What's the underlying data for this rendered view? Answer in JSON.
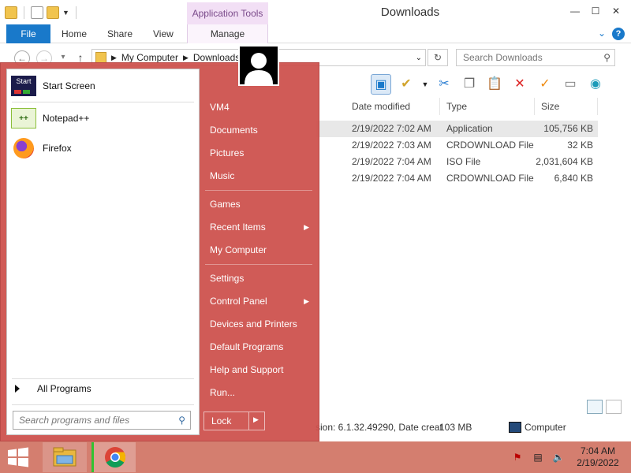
{
  "window": {
    "title": "Downloads",
    "context_tab_group": "Application Tools",
    "ribbon_tabs": [
      "File",
      "Home",
      "Share",
      "View",
      "Manage"
    ],
    "address_path": [
      "My Computer",
      "Downloads"
    ],
    "search_placeholder": "Search Downloads",
    "columns": [
      "Date modified",
      "Type",
      "Size"
    ],
    "files": [
      {
        "date": "2/19/2022 7:02 AM",
        "type": "Application",
        "size": "105,756 KB",
        "selected": true
      },
      {
        "date": "2/19/2022 7:03 AM",
        "type": "CRDOWNLOAD File",
        "size": "32 KB",
        "selected": false
      },
      {
        "date": "2/19/2022 7:04 AM",
        "type": "ISO File",
        "size": "2,031,604 KB",
        "selected": false
      },
      {
        "date": "2/19/2022 7:04 AM",
        "type": "CRDOWNLOAD File",
        "size": "6,840 KB",
        "selected": false
      }
    ],
    "status": {
      "details": "sion: 6.1.32.49290, Date creat",
      "size": "103 MB",
      "location": "Computer"
    }
  },
  "start_menu": {
    "pinned": [
      {
        "label": "Start Screen",
        "icon": "start-screen-icon"
      },
      {
        "label": "Notepad++",
        "icon": "notepadpp-icon"
      },
      {
        "label": "Firefox",
        "icon": "firefox-icon"
      }
    ],
    "start_screen_icon_text": "Start",
    "all_programs": "All Programs",
    "search_placeholder": "Search programs and files",
    "right_items": [
      {
        "label": "VM4",
        "arrow": false
      },
      {
        "label": "Documents",
        "arrow": false
      },
      {
        "label": "Pictures",
        "arrow": false
      },
      {
        "label": "Music",
        "arrow": false
      },
      {
        "label": "Games",
        "arrow": false
      },
      {
        "label": "Recent Items",
        "arrow": true
      },
      {
        "label": "My Computer",
        "arrow": false
      },
      {
        "label": "Settings",
        "arrow": false
      },
      {
        "label": "Control Panel",
        "arrow": true
      },
      {
        "label": "Devices and Printers",
        "arrow": false
      },
      {
        "label": "Default Programs",
        "arrow": false
      },
      {
        "label": "Help and Support",
        "arrow": false
      },
      {
        "label": "Run...",
        "arrow": false
      }
    ],
    "lock_label": "Lock",
    "accent": "#cd514d"
  },
  "taskbar": {
    "time": "7:04 AM",
    "date": "2/19/2022",
    "color": "#d47e6f"
  }
}
